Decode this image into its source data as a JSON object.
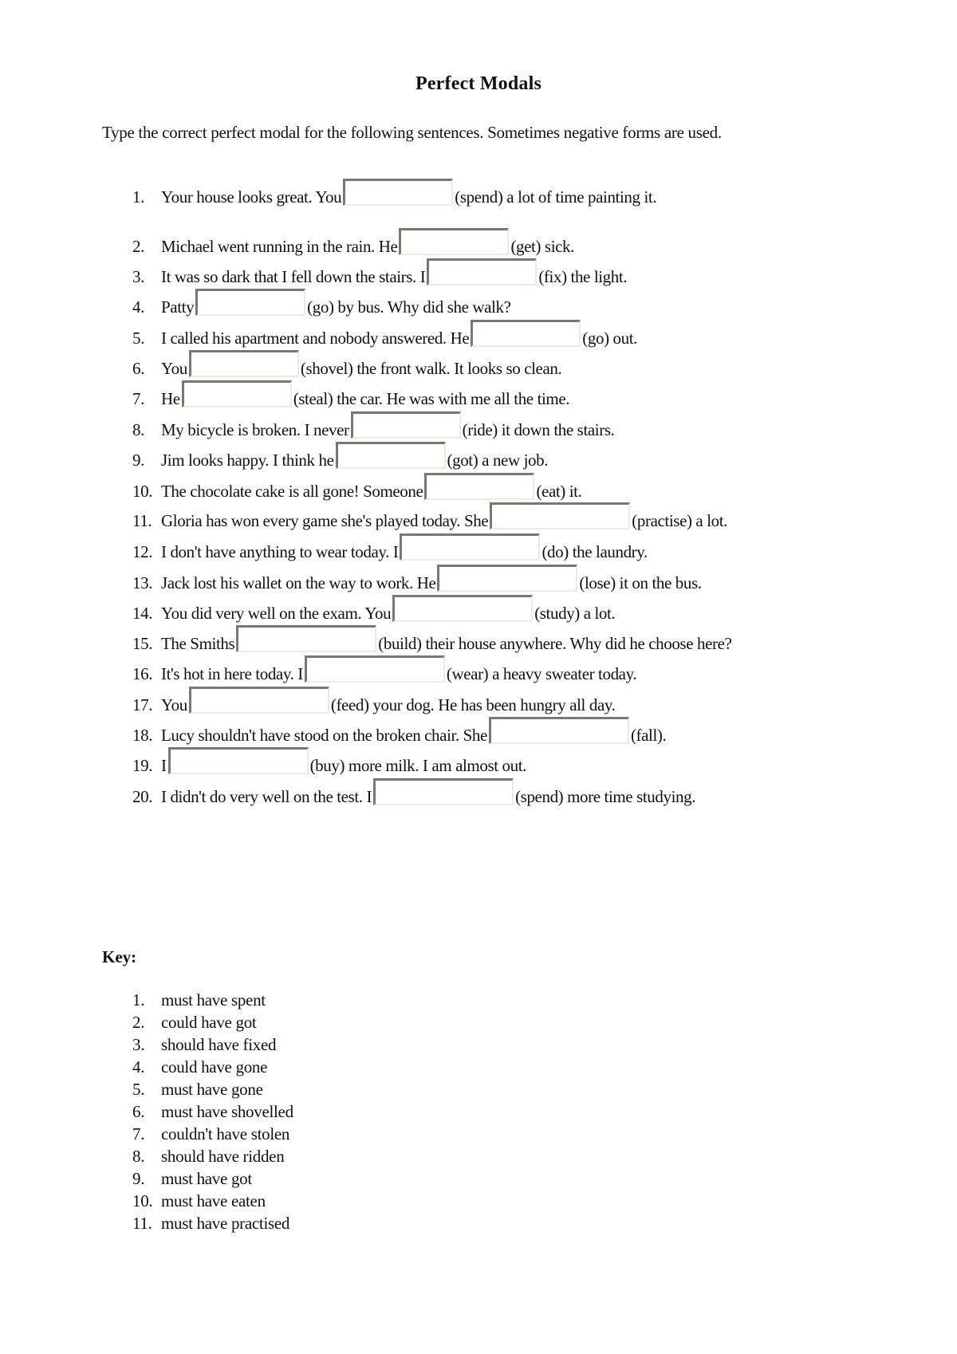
{
  "title": "Perfect Modals",
  "instructions": "Type the correct perfect modal for the following sentences. Sometimes negative forms are used.",
  "questions": [
    {
      "num": "1.",
      "before": "Your house looks great. You",
      "after": "(spend) a lot of time painting it.",
      "value": ""
    },
    {
      "num": "2.",
      "before": "Michael went running in the rain. He",
      "after": "(get) sick.",
      "value": ""
    },
    {
      "num": "3.",
      "before": "It was so dark that I fell down the stairs. I",
      "after": "(fix) the light.",
      "value": ""
    },
    {
      "num": "4.",
      "before": "Patty",
      "after": "(go) by bus. Why did she walk?",
      "value": ""
    },
    {
      "num": "5.",
      "before": "I called his apartment and nobody answered. He",
      "after": "(go) out.",
      "value": ""
    },
    {
      "num": "6.",
      "before": "You",
      "after": "(shovel) the front walk. It looks so clean.",
      "value": ""
    },
    {
      "num": "7.",
      "before": "He",
      "after": "(steal) the car. He was with me all the time.",
      "value": ""
    },
    {
      "num": "8.",
      "before": "My bicycle is broken. I never",
      "after": "(ride) it down the stairs.",
      "value": ""
    },
    {
      "num": "9.",
      "before": "Jim looks happy. I think he",
      "after": "(got) a new job.",
      "value": ""
    },
    {
      "num": "10.",
      "before": "The chocolate cake is all gone! Someone",
      "after": "(eat) it.",
      "value": ""
    },
    {
      "num": "11.",
      "before": "Gloria has won every game she's played today. She",
      "after": "(practise) a lot.",
      "value": ""
    },
    {
      "num": "12.",
      "before": "I don't have anything to wear today. I",
      "after": "(do) the laundry.",
      "value": ""
    },
    {
      "num": "13.",
      "before": "Jack lost his wallet on the way to work. He",
      "after": "(lose) it on the bus.",
      "value": ""
    },
    {
      "num": "14.",
      "before": "You did very well on the exam. You",
      "after": "(study) a lot.",
      "value": ""
    },
    {
      "num": "15.",
      "before": "The Smiths",
      "after": "(build) their house anywhere. Why did he choose here?",
      "value": ""
    },
    {
      "num": "16.",
      "before": "It's hot in here today. I",
      "after": "(wear) a heavy sweater today.",
      "value": ""
    },
    {
      "num": "17.",
      "before": "You",
      "after": "(feed) your dog. He has been hungry all day.",
      "value": ""
    },
    {
      "num": "18.",
      "before": "Lucy shouldn't have stood on the broken chair. She",
      "after": "(fall).",
      "value": ""
    },
    {
      "num": "19.",
      "before": "I",
      "after": "(buy) more milk. I am almost out.",
      "value": ""
    },
    {
      "num": "20.",
      "before": "I didn't do very well on the test. I",
      "after": "(spend) more time studying.",
      "value": ""
    }
  ],
  "key": {
    "heading": "Key:",
    "answers": [
      {
        "num": "1.",
        "text": "must have spent"
      },
      {
        "num": "2.",
        "text": "could have got"
      },
      {
        "num": "3.",
        "text": "should have fixed"
      },
      {
        "num": "4.",
        "text": "could have gone"
      },
      {
        "num": "5.",
        "text": "must have gone"
      },
      {
        "num": "6.",
        "text": "must have shovelled"
      },
      {
        "num": "7.",
        "text": "couldn't have stolen"
      },
      {
        "num": "8.",
        "text": "should have ridden"
      },
      {
        "num": "9.",
        "text": "must have got"
      },
      {
        "num": "10.",
        "text": "must have eaten"
      },
      {
        "num": "11.",
        "text": "must have practised"
      }
    ]
  }
}
